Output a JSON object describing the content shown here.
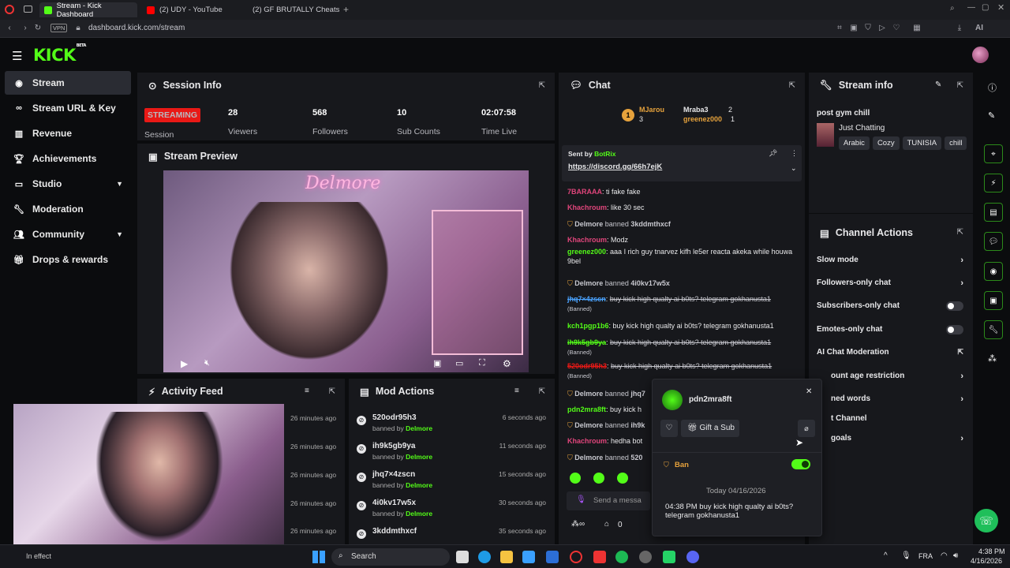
{
  "browser": {
    "tabs": [
      {
        "label": "Stream - Kick Dashboard",
        "color": "#53fc18"
      },
      {
        "label": "(2) UDY - YouTube",
        "color": "#ff0000"
      },
      {
        "label": "(2) GF BRUTALLY Cheats c",
        "color": "#ff0000"
      }
    ],
    "url": "dashboard.kick.com/stream",
    "vpn": "VPN",
    "ai": "AI"
  },
  "app": {
    "logo": "KICK",
    "logo_sup": "BETA"
  },
  "sidebar": {
    "items": [
      {
        "label": "Stream",
        "icon": "broadcast-icon"
      },
      {
        "label": "Stream URL & Key",
        "icon": "link-icon"
      },
      {
        "label": "Revenue",
        "icon": "chart-icon"
      },
      {
        "label": "Achievements",
        "icon": "trophy-icon"
      },
      {
        "label": "Studio",
        "icon": "studio-icon"
      },
      {
        "label": "Moderation",
        "icon": "wrench-icon"
      },
      {
        "label": "Community",
        "icon": "users-icon"
      },
      {
        "label": "Drops & rewards",
        "icon": "gift-icon"
      }
    ]
  },
  "session": {
    "title": "Session Info",
    "status": "STREAMING",
    "status_label": "Session",
    "viewers": "28",
    "viewers_label": "Viewers",
    "followers": "568",
    "followers_label": "Followers",
    "subs": "10",
    "subs_label": "Sub Counts",
    "time": "02:07:58",
    "time_label": "Time Live"
  },
  "preview": {
    "title": "Stream Preview",
    "neon": "Delmore"
  },
  "activity": {
    "title": "Activity Feed",
    "times": [
      "26 minutes ago",
      "26 minutes ago",
      "26 minutes ago",
      "26 minutes ago",
      "26 minutes ago"
    ],
    "status": "In effect"
  },
  "modactions": {
    "title": "Mod Actions",
    "banned_prefix": "banned by",
    "moderator": "Delmore",
    "rows": [
      {
        "user": "520odr95h3",
        "time": "6 seconds ago"
      },
      {
        "user": "ih9k5gb9ya",
        "time": "11 seconds ago"
      },
      {
        "user": "jhq7×4zscn",
        "time": "15 seconds ago"
      },
      {
        "user": "4i0kv17w5x",
        "time": "30 seconds ago"
      },
      {
        "user": "3kddmthxcf",
        "time": "35 seconds ago"
      }
    ]
  },
  "chat": {
    "title": "Chat",
    "top": [
      {
        "name": "MJarou",
        "n": "3"
      },
      {
        "name": "Mraba3",
        "n": "2"
      },
      {
        "name": "greenez000",
        "n": "1"
      }
    ],
    "pinned": {
      "sent_by": "Sent by",
      "bot": "BotRix",
      "link": "https://discord.gg/66h7ejK"
    },
    "messages": [
      {
        "user": "7BARAAA",
        "text": "ti fake fake",
        "color": "#e0457b"
      },
      {
        "user": "Khachroum",
        "text": "like 30 sec",
        "color": "#e0457b"
      },
      {
        "sys": "Delmore",
        "mid": "banned",
        "target": "3kddmthxcf"
      },
      {
        "user": "Khachroum",
        "text": "Modz",
        "color": "#e0457b"
      },
      {
        "user": "greenez000",
        "text": "aaa I rich guy tnarvez kifh le5er reacta akeka while houwa 9bel",
        "color": "#53fc18"
      },
      {
        "sys": "Delmore",
        "mid": "banned",
        "target": "4i0kv17w5x"
      },
      {
        "user": "jhq7×4zscn",
        "text": "buy kick high qualty ai b0ts? telegram gokhanusta1",
        "color": "#4aa3ff",
        "banned": "(Banned)"
      },
      {
        "user": "kch1pgp1b6",
        "text": "buy kick high qualty ai b0ts? telegram gokhanusta1",
        "color": "#53fc18"
      },
      {
        "user": "ih9k5gb9ya",
        "text": "buy kick high qualty ai b0ts? telegram gokhanusta1",
        "color": "#53fc18",
        "banned": "(Banned)"
      },
      {
        "user": "520odr95h3",
        "text": "buy kick high qualty ai b0ts? telegram gokhanusta1",
        "color": "#e91916",
        "banned": "(Banned)"
      },
      {
        "sys": "Delmore",
        "mid": "banned",
        "target": "jhq7"
      },
      {
        "user": "pdn2mra8ft",
        "text": "buy kick h",
        "color": "#53fc18"
      },
      {
        "sys": "Delmore",
        "mid": "banned",
        "target": "ih9k"
      },
      {
        "user": "Khachroum",
        "text": "hedha bot",
        "color": "#e0457b"
      },
      {
        "sys": "Delmore",
        "mid": "banned",
        "target": "520"
      }
    ],
    "input_placeholder": "Send a messa",
    "points": "0"
  },
  "streaminfo": {
    "title": "Stream info",
    "stream_title": "post gym chill",
    "category": "Just Chatting",
    "tags": [
      "Arabic",
      "Cozy",
      "TUNISIA",
      "chill"
    ]
  },
  "channel_actions": {
    "title": "Channel Actions",
    "items": [
      {
        "label": "Slow mode",
        "kind": "arrow"
      },
      {
        "label": "Followers-only chat",
        "kind": "arrow"
      },
      {
        "label": "Subscribers-only chat",
        "kind": "toggle"
      },
      {
        "label": "Emotes-only chat",
        "kind": "toggle"
      },
      {
        "label": "AI Chat Moderation",
        "kind": "popout"
      },
      {
        "label": "ount age restriction",
        "kind": "arrow"
      },
      {
        "label": "ned words",
        "kind": "arrow"
      },
      {
        "label": "t Channel",
        "kind": "none"
      },
      {
        "label": "goals",
        "kind": "arrow"
      }
    ]
  },
  "usercard": {
    "username": "pdn2mra8ft",
    "gift": "Gift a Sub",
    "ban_label": "Ban",
    "date": "Today 04/16/2026",
    "message": "04:38 PM buy kick high qualty ai b0ts? telegram gokhanusta1"
  },
  "taskbar": {
    "search": "Search",
    "lang": "FRA",
    "time": "4:38 PM",
    "date": "4/16/2026"
  },
  "colors": {
    "accent": "#53fc18",
    "live": "#e91916",
    "panel": "#17181c"
  }
}
